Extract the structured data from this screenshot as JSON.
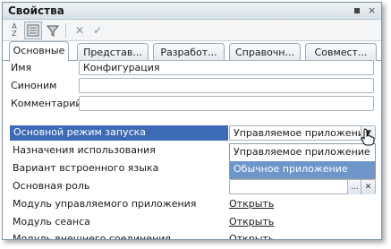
{
  "window": {
    "title": "Свойства",
    "controls": [
      "×"
    ]
  },
  "toolbar": {
    "items": [
      {
        "name": "sort-az-icon",
        "glyph": "A↓Z",
        "pressed": false
      },
      {
        "name": "categories-icon",
        "glyph": "☷",
        "pressed": true
      },
      {
        "name": "filter-icon",
        "glyph": "⏷",
        "pressed": false
      },
      {
        "name": "delete-icon",
        "glyph": "✕",
        "pressed": false
      },
      {
        "name": "check-icon",
        "glyph": "✓",
        "pressed": false
      }
    ]
  },
  "tabs": [
    "Основные",
    "Представ...",
    "Разработ...",
    "Справочн...",
    "Совмест..."
  ],
  "active_tab": 0,
  "fields": {
    "name": {
      "label": "Имя",
      "value": "Конфигурация"
    },
    "synonym": {
      "label": "Синоним",
      "value": ""
    },
    "comment": {
      "label": "Комментарий",
      "value": ""
    }
  },
  "properties": {
    "launch_mode": {
      "label": "Основной режим запуска",
      "value": "Управляемое приложение"
    },
    "usage_purpose": {
      "label": "Назначения использования"
    },
    "builtin_lang": {
      "label": "Вариант встроенного языка"
    },
    "main_role": {
      "label": "Основная роль",
      "value": "",
      "button": "..."
    },
    "managed_app_module": {
      "label": "Модуль управляемого приложения",
      "link": "Открыть"
    },
    "session_module": {
      "label": "Модуль сеанса",
      "link": "Открыть"
    },
    "external_conn_module": {
      "label": "Модуль внешнего соединения",
      "link": "Открыть"
    }
  },
  "dropdown": {
    "options": [
      "Управляемое приложение",
      "Обычное приложение"
    ],
    "selected": 1
  },
  "colors": {
    "selection": "#3e6bb6",
    "dropdown_highlight": "#6e96cb",
    "border": "#a6b4bf"
  }
}
